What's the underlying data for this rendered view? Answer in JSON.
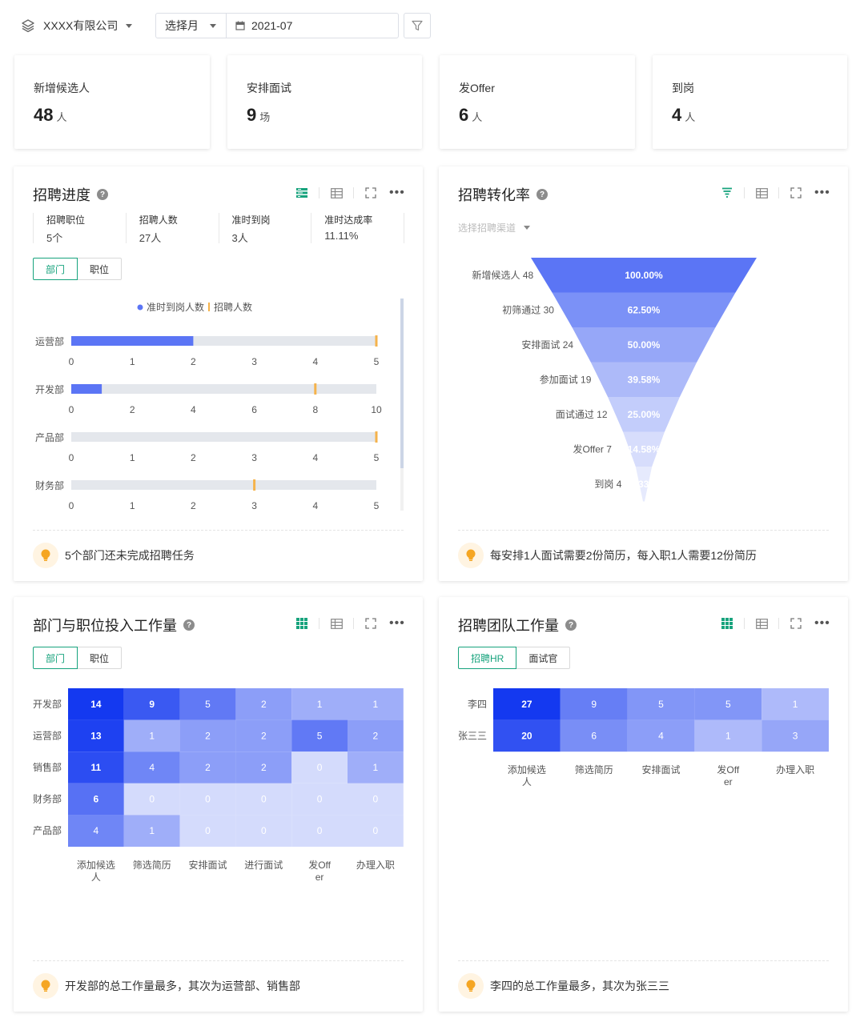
{
  "header": {
    "company": "XXXX有限公司",
    "period_select": "选择月",
    "date": "2021-07"
  },
  "kpis": [
    {
      "label": "新增候选人",
      "value": "48",
      "unit": "人"
    },
    {
      "label": "安排面试",
      "value": "9",
      "unit": "场"
    },
    {
      "label": "发Offer",
      "value": "6",
      "unit": "人"
    },
    {
      "label": "到岗",
      "value": "4",
      "unit": "人"
    }
  ],
  "progress": {
    "title": "招聘进度",
    "help": "?",
    "stats": [
      {
        "label": "招聘职位",
        "value": "5个"
      },
      {
        "label": "招聘人数",
        "value": "27人"
      },
      {
        "label": "准时到岗",
        "value": "3人"
      },
      {
        "label": "准时达成率",
        "value": "11.11%"
      }
    ],
    "tabs": [
      "部门",
      "职位"
    ],
    "legend": {
      "arrived": "准时到岗人数",
      "hiring": "招聘人数"
    },
    "tip": "5个部门还未完成招聘任务"
  },
  "conversion": {
    "title": "招聘转化率",
    "help": "?",
    "channel_placeholder": "选择招聘渠道",
    "tip": "每安排1人面试需要2份简历，每入职1人需要12份简历"
  },
  "workload": {
    "title": "部门与职位投入工作量",
    "help": "?",
    "tabs": [
      "部门",
      "职位"
    ],
    "tip": "开发部的总工作量最多，其次为运营部、销售部"
  },
  "team": {
    "title": "招聘团队工作量",
    "help": "?",
    "tabs": [
      "招聘HR",
      "面试官"
    ],
    "tip": "李四的总工作量最多，其次为张三三"
  },
  "colors": {
    "accent_green": "#17a37d",
    "bar_blue": "#5b75f5",
    "marker_orange": "#f5b34c",
    "track_gray": "#e4e7ec"
  },
  "chart_data": [
    {
      "type": "bar",
      "orientation": "horizontal",
      "categories": [
        "运营部",
        "开发部",
        "产品部",
        "财务部"
      ],
      "series": [
        {
          "name": "准时到岗人数",
          "values": [
            2,
            1,
            0,
            0
          ]
        },
        {
          "name": "招聘人数",
          "values": [
            5,
            8,
            5,
            3
          ]
        }
      ],
      "axis_max": [
        5,
        10,
        5,
        5
      ],
      "ticks": [
        [
          "0",
          "1",
          "2",
          "3",
          "4",
          "5"
        ],
        [
          "0",
          "2",
          "4",
          "6",
          "8",
          "10"
        ],
        [
          "0",
          "1",
          "2",
          "3",
          "4",
          "5"
        ],
        [
          "0",
          "1",
          "2",
          "3",
          "4",
          "5"
        ]
      ],
      "legend": "top-center"
    },
    {
      "type": "funnel",
      "stages": [
        {
          "label": "新增候选人 48",
          "value": 48,
          "percent": "100.00%"
        },
        {
          "label": "初筛通过 30",
          "value": 30,
          "percent": "62.50%"
        },
        {
          "label": "安排面试 24",
          "value": 24,
          "percent": "50.00%"
        },
        {
          "label": "参加面试 19",
          "value": 19,
          "percent": "39.58%"
        },
        {
          "label": "面试通过 12",
          "value": 12,
          "percent": "25.00%"
        },
        {
          "label": "发Offer 7",
          "value": 7,
          "percent": "14.58%"
        },
        {
          "label": "到岗 4",
          "value": 4,
          "percent": "8.33%"
        }
      ]
    },
    {
      "type": "heatmap",
      "rows": [
        "开发部",
        "运营部",
        "销售部",
        "财务部",
        "产品部"
      ],
      "columns": [
        "添加候选人",
        "筛选简历",
        "安排面试",
        "进行面试",
        "发Offer",
        "办理入职"
      ],
      "values": [
        [
          14,
          9,
          5,
          2,
          1,
          1
        ],
        [
          13,
          1,
          2,
          2,
          5,
          2
        ],
        [
          11,
          4,
          2,
          2,
          0,
          1
        ],
        [
          6,
          0,
          0,
          0,
          0,
          0
        ],
        [
          4,
          1,
          0,
          0,
          0,
          0
        ]
      ],
      "max": 14
    },
    {
      "type": "heatmap",
      "rows": [
        "李四",
        "张三三"
      ],
      "columns": [
        "添加候选人",
        "筛选简历",
        "安排面试",
        "发Offer",
        "办理入职"
      ],
      "values": [
        [
          27,
          9,
          5,
          5,
          1
        ],
        [
          20,
          6,
          4,
          1,
          3
        ]
      ],
      "max": 27
    }
  ]
}
